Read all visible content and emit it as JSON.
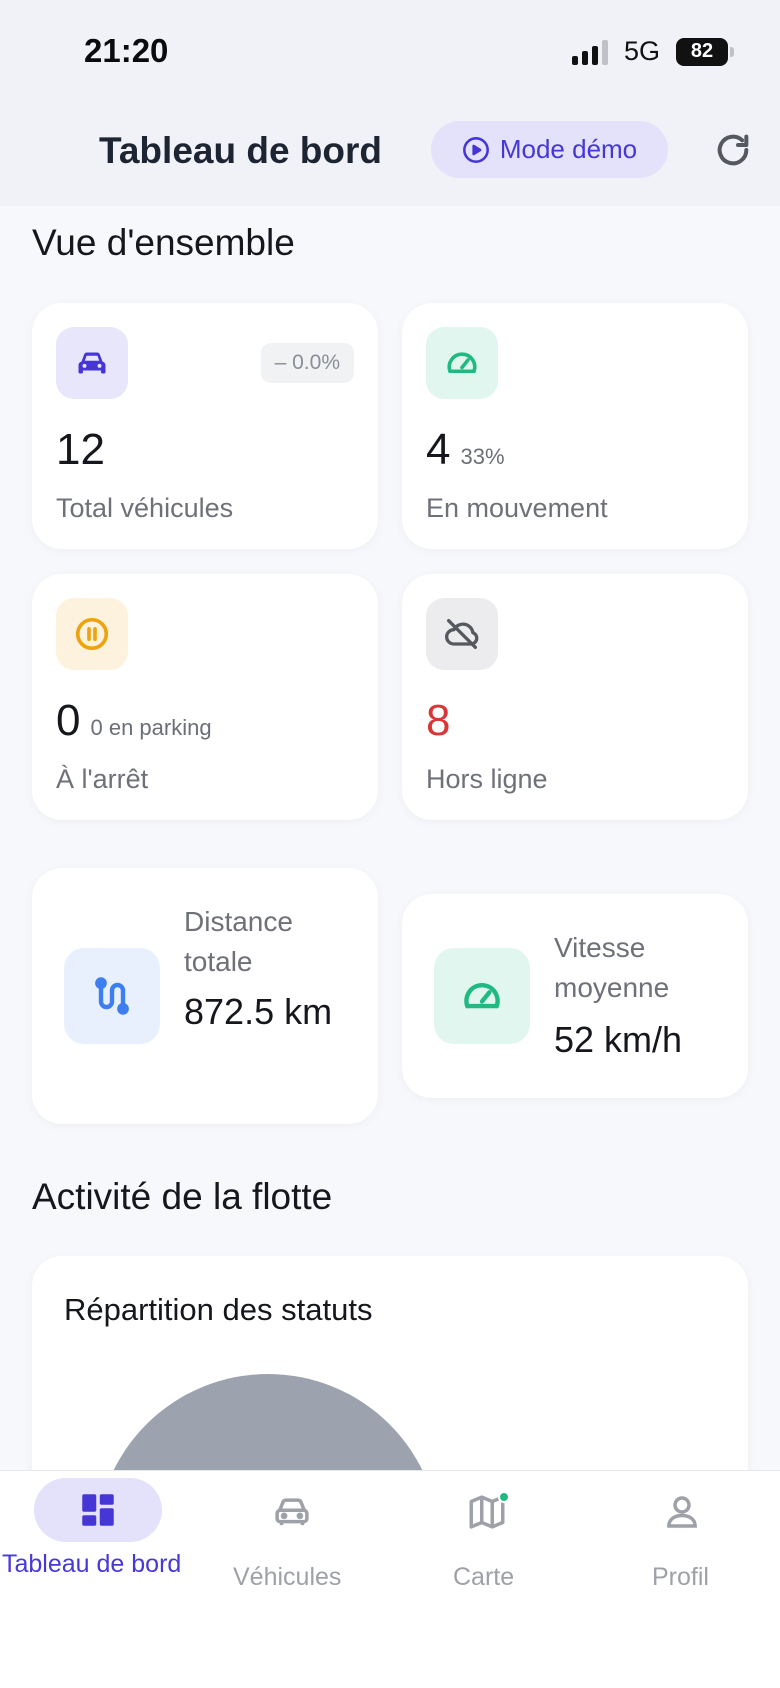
{
  "status_bar": {
    "time": "21:20",
    "network": "5G",
    "battery": "82"
  },
  "header": {
    "title": "Tableau de bord",
    "demo_label": "Mode démo"
  },
  "overview": {
    "title": "Vue d'ensemble",
    "cards": [
      {
        "value": "12",
        "sub": "",
        "label": "Total véhicules",
        "trend": "– 0.0%",
        "icon": "car-icon"
      },
      {
        "value": "4",
        "sub": "33%",
        "label": "En mouvement",
        "icon": "speedometer-icon"
      },
      {
        "value": "0",
        "sub": "0 en parking",
        "label": "À l'arrêt",
        "icon": "pause-icon"
      },
      {
        "value": "8",
        "sub": "",
        "label": "Hors ligne",
        "icon": "cloud-off-icon"
      }
    ]
  },
  "metrics": {
    "distance": {
      "label": "Distance totale",
      "value": "872.5 km",
      "icon": "route-icon"
    },
    "speed": {
      "label": "Vitesse moyenne",
      "value": "52 km/h",
      "icon": "speedometer-icon"
    }
  },
  "activity": {
    "title": "Activité de la flotte",
    "chart_title": "Répartition des statuts"
  },
  "nav": [
    {
      "label": "Tableau de bord",
      "icon": "dashboard-icon",
      "active": true
    },
    {
      "label": "Véhicules",
      "icon": "car-icon"
    },
    {
      "label": "Carte",
      "icon": "map-icon"
    },
    {
      "label": "Profil",
      "icon": "user-icon"
    }
  ],
  "colors": {
    "accent": "#4636d6",
    "green": "#1fb981",
    "orange": "#eea20d",
    "red": "#d93636",
    "blue": "#3d7ef0"
  }
}
